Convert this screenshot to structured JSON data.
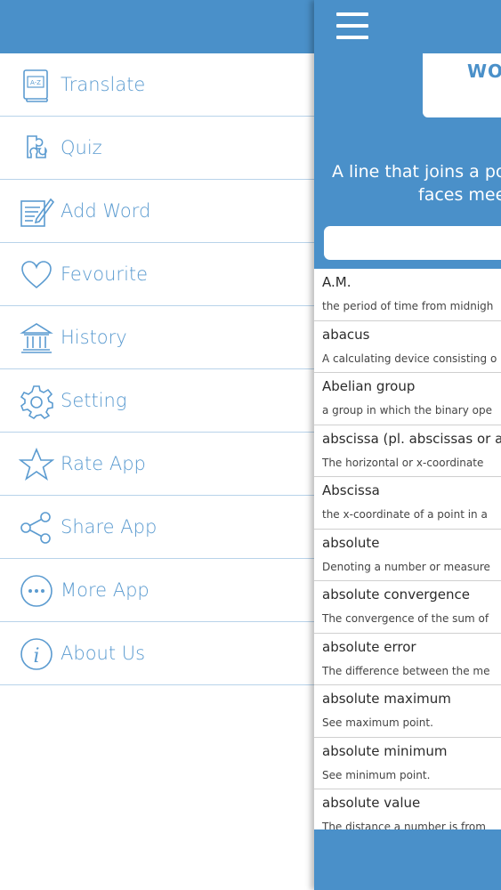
{
  "colors": {
    "accent": "#4a90c9",
    "menu_text": "#5b9bd0",
    "divider": "#b8d3ea"
  },
  "menu": {
    "items": [
      {
        "label": "Translate",
        "icon": "dictionary-icon"
      },
      {
        "label": "Quiz",
        "icon": "puzzle-icon"
      },
      {
        "label": "Add Word",
        "icon": "edit-note-icon"
      },
      {
        "label": "Fevourite",
        "icon": "heart-icon"
      },
      {
        "label": "History",
        "icon": "bank-icon"
      },
      {
        "label": "Setting",
        "icon": "gear-icon"
      },
      {
        "label": "Rate App",
        "icon": "star-icon"
      },
      {
        "label": "Share App",
        "icon": "share-icon"
      },
      {
        "label": "More App",
        "icon": "more-dots-icon"
      },
      {
        "label": "About Us",
        "icon": "info-icon"
      }
    ]
  },
  "main": {
    "word_card_text": "WO",
    "definition_line1": "A line that joins a po",
    "definition_line2": "faces mee",
    "search_placeholder": ""
  },
  "words": [
    {
      "term": "A.M.",
      "definition": "the period of time from midnigh"
    },
    {
      "term": "abacus",
      "definition": "A calculating device consisting o"
    },
    {
      "term": "Abelian group",
      "definition": "a group in which the binary ope"
    },
    {
      "term": "abscissa (pl. abscissas or ab-",
      "definition": "The horizontal or x-coordinate"
    },
    {
      "term": "Abscissa",
      "definition": "the x-coordinate of a point in a"
    },
    {
      "term": "absolute",
      "definition": "Denoting a number or measure"
    },
    {
      "term": "absolute convergence",
      "definition": "The convergence of the sum of"
    },
    {
      "term": "absolute error",
      "definition": "The difference between the me"
    },
    {
      "term": "absolute maximum",
      "definition": "See maximum point."
    },
    {
      "term": "absolute minimum",
      "definition": "See minimum point."
    },
    {
      "term": "absolute value",
      "definition": "The distance a number is from"
    }
  ]
}
